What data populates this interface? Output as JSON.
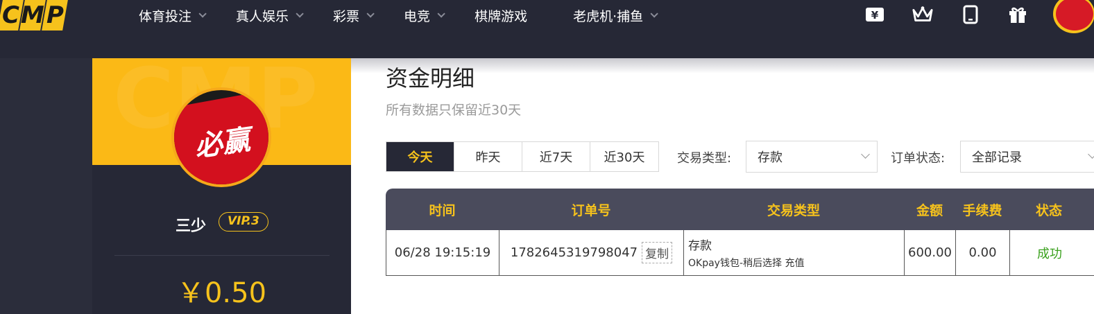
{
  "header": {
    "logo_letters": [
      "C",
      "M",
      "P"
    ],
    "nav": [
      {
        "label": "体育投注",
        "has_dropdown": true
      },
      {
        "label": "真人娱乐",
        "has_dropdown": true
      },
      {
        "label": "彩票",
        "has_dropdown": true
      },
      {
        "label": "电竞",
        "has_dropdown": true
      },
      {
        "label": "棋牌游戏",
        "has_dropdown": false
      },
      {
        "label": "老虎机·捕鱼",
        "has_dropdown": true
      }
    ],
    "icons": [
      "yen-wallet-icon",
      "crown-icon",
      "tablet-icon",
      "gift-icon"
    ]
  },
  "profile": {
    "avatar_text": "必赢",
    "username": "三少",
    "vip": "VIP.3",
    "balance": "￥0.50"
  },
  "page": {
    "title": "资金明细",
    "subtitle": "所有数据只保留近30天",
    "tabs": [
      "今天",
      "昨天",
      "近7天",
      "近30天"
    ],
    "active_tab": 0,
    "type_label": "交易类型:",
    "type_value": "存款",
    "status_label": "订单状态:",
    "status_value": "全部记录"
  },
  "table": {
    "headers": [
      "时间",
      "订单号",
      "交易类型",
      "金额",
      "手续费",
      "状态"
    ],
    "rows": [
      {
        "time": "06/28 19:15:19",
        "order_no": "1782645319798047",
        "copy_label": "复制",
        "type_line1": "存款",
        "type_line2": "OKpay钱包-稍后选择 充值",
        "amount": "600.00",
        "fee": "0.00",
        "status": "成功"
      }
    ]
  },
  "colors": {
    "accent": "#f6c21c",
    "dark": "#262836",
    "success": "#3aa11d"
  }
}
